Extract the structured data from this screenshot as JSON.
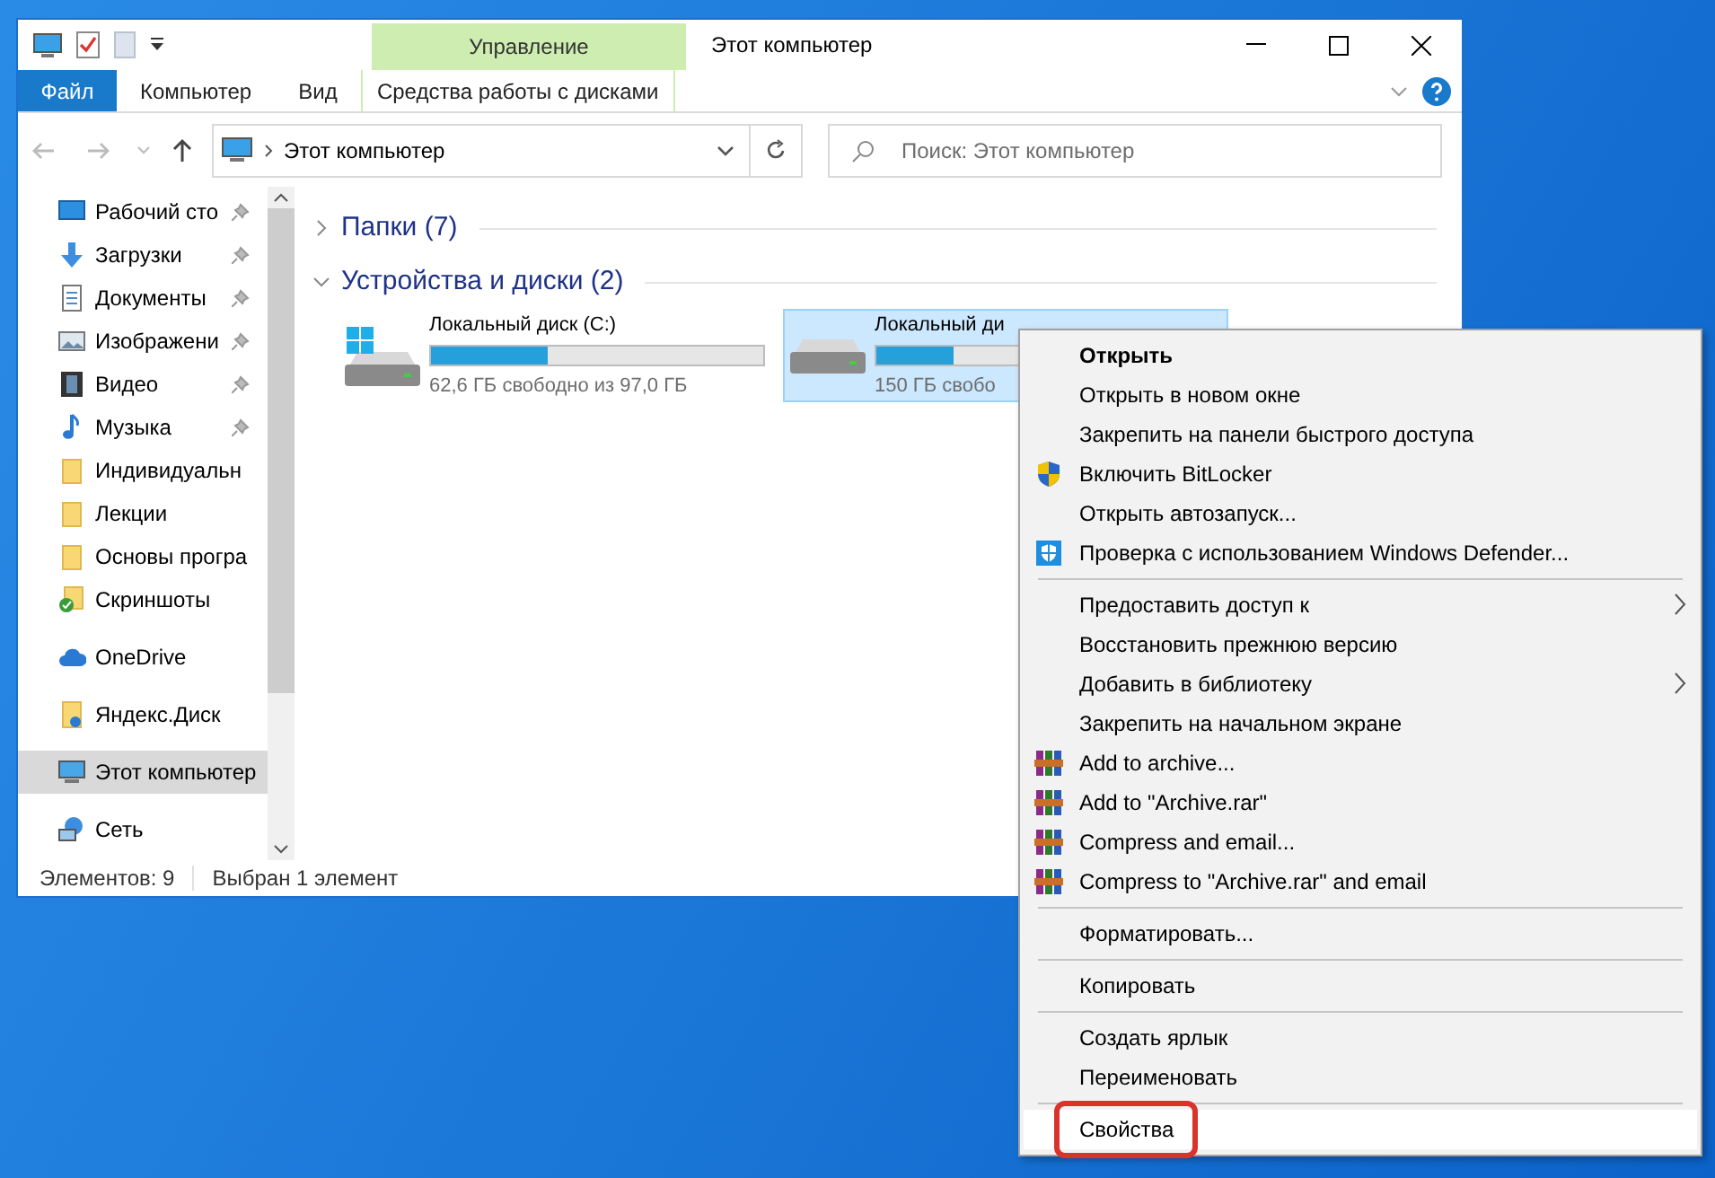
{
  "window": {
    "title": "Этот компьютер",
    "contextual_group": "Управление"
  },
  "ribbon": {
    "tabs": [
      {
        "label": "Файл",
        "kind": "file"
      },
      {
        "label": "Компьютер",
        "kind": "tab"
      },
      {
        "label": "Вид",
        "kind": "tab"
      },
      {
        "label": "Средства работы с дисками",
        "kind": "contextual"
      }
    ]
  },
  "address_bar": {
    "path": "Этот компьютер"
  },
  "search": {
    "placeholder": "Поиск: Этот компьютер"
  },
  "sidebar": {
    "sections": [
      {
        "items": [
          {
            "label": "Рабочий сто",
            "kind": "desktop",
            "pinned": true,
            "selected": false
          },
          {
            "label": "Загрузки",
            "kind": "downloads",
            "pinned": true,
            "selected": false
          },
          {
            "label": "Документы",
            "kind": "documents",
            "pinned": true,
            "selected": false
          },
          {
            "label": "Изображени",
            "kind": "pictures",
            "pinned": true,
            "selected": false
          },
          {
            "label": "Видео",
            "kind": "video",
            "pinned": true,
            "selected": false
          },
          {
            "label": "Музыка",
            "kind": "music",
            "pinned": true,
            "selected": false
          },
          {
            "label": "Индивидуальн",
            "kind": "folder",
            "pinned": false,
            "selected": false
          },
          {
            "label": "Лекции",
            "kind": "folder",
            "pinned": false,
            "selected": false
          },
          {
            "label": "Основы програ",
            "kind": "folder",
            "pinned": false,
            "selected": false
          },
          {
            "label": "Скриншоты",
            "kind": "screenshots",
            "pinned": false,
            "selected": false
          }
        ]
      },
      {
        "items": [
          {
            "label": "OneDrive",
            "kind": "cloud",
            "pinned": false,
            "selected": false
          }
        ]
      },
      {
        "items": [
          {
            "label": "Яндекс.Диск",
            "kind": "yadisk",
            "pinned": false,
            "selected": false
          }
        ]
      },
      {
        "items": [
          {
            "label": "Этот компьютер",
            "kind": "computer",
            "pinned": false,
            "selected": true
          }
        ]
      },
      {
        "items": [
          {
            "label": "Сеть",
            "kind": "network",
            "pinned": false,
            "selected": false
          }
        ]
      }
    ]
  },
  "content": {
    "groups": [
      {
        "label": "Папки (7)",
        "expanded": false
      },
      {
        "label": "Устройства и диски (2)",
        "expanded": true,
        "drives": [
          {
            "name": "Локальный диск (C:)",
            "free": "62,6 ГБ свободно из 97,0 ГБ",
            "level": 0.35,
            "kind": "system",
            "selected": false
          },
          {
            "name": "Локальный ди",
            "free": "150 ГБ свобо",
            "level": 0.23,
            "kind": "plain",
            "selected": true
          }
        ]
      }
    ]
  },
  "status_bar": {
    "count": "Элементов: 9",
    "selection": "Выбран 1 элемент"
  },
  "context_menu": {
    "groups": [
      {
        "items": [
          {
            "label": "Открыть",
            "kind": "plain",
            "default": true,
            "submenu": false,
            "highlighted": false
          },
          {
            "label": "Открыть в новом окне",
            "kind": "plain",
            "default": false,
            "submenu": false,
            "highlighted": false
          },
          {
            "label": "Закрепить на панели быстрого доступа",
            "kind": "plain",
            "default": false,
            "submenu": false,
            "highlighted": false
          },
          {
            "label": "Включить BitLocker",
            "kind": "shield",
            "default": false,
            "submenu": false,
            "highlighted": false
          },
          {
            "label": "Открыть автозапуск...",
            "kind": "plain",
            "default": false,
            "submenu": false,
            "highlighted": false
          },
          {
            "label": "Проверка с использованием Windows Defender...",
            "kind": "defender",
            "default": false,
            "submenu": false,
            "highlighted": false
          }
        ]
      },
      {
        "items": [
          {
            "label": "Предоставить доступ к",
            "kind": "plain",
            "default": false,
            "submenu": true,
            "highlighted": false
          },
          {
            "label": "Восстановить прежнюю версию",
            "kind": "plain",
            "default": false,
            "submenu": false,
            "highlighted": false
          },
          {
            "label": "Добавить в библиотеку",
            "kind": "plain",
            "default": false,
            "submenu": true,
            "highlighted": false
          },
          {
            "label": "Закрепить на начальном экране",
            "kind": "plain",
            "default": false,
            "submenu": false,
            "highlighted": false
          },
          {
            "label": "Add to archive...",
            "kind": "archive",
            "default": false,
            "submenu": false,
            "highlighted": false
          },
          {
            "label": "Add to \"Archive.rar\"",
            "kind": "archive",
            "default": false,
            "submenu": false,
            "highlighted": false
          },
          {
            "label": "Compress and email...",
            "kind": "archive",
            "default": false,
            "submenu": false,
            "highlighted": false
          },
          {
            "label": "Compress to \"Archive.rar\" and email",
            "kind": "archive",
            "default": false,
            "submenu": false,
            "highlighted": false
          }
        ]
      },
      {
        "items": [
          {
            "label": "Форматировать...",
            "kind": "plain",
            "default": false,
            "submenu": false,
            "highlighted": false
          }
        ]
      },
      {
        "items": [
          {
            "label": "Копировать",
            "kind": "plain",
            "default": false,
            "submenu": false,
            "highlighted": false
          }
        ]
      },
      {
        "items": [
          {
            "label": "Создать ярлык",
            "kind": "plain",
            "default": false,
            "submenu": false,
            "highlighted": false
          },
          {
            "label": "Переименовать",
            "kind": "plain",
            "default": false,
            "submenu": false,
            "highlighted": false
          }
        ]
      },
      {
        "items": [
          {
            "label": "Свойства",
            "kind": "plain",
            "default": false,
            "submenu": false,
            "highlighted": true
          }
        ]
      }
    ]
  }
}
